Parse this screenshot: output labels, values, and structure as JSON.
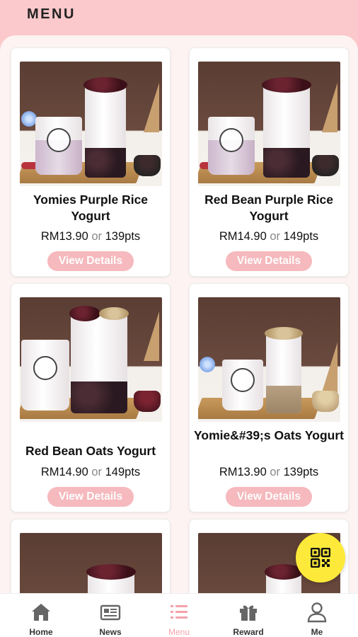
{
  "header": {
    "title": "MENU"
  },
  "products": [
    {
      "name": "Yomies Purple Rice Yogurt",
      "price": "RM13.90",
      "or": "or",
      "points": "139pts",
      "button": "View Details"
    },
    {
      "name": "Red Bean Purple Rice Yogurt",
      "price": "RM14.90",
      "or": "or",
      "points": "149pts",
      "button": "View Details"
    },
    {
      "name": "Red Bean Oats Yogurt",
      "price": "RM14.90",
      "or": "or",
      "points": "149pts",
      "button": "View Details"
    },
    {
      "name": "Yomie&#39;s Oats Yogurt",
      "price": "RM13.90",
      "or": "or",
      "points": "139pts",
      "button": "View Details"
    }
  ],
  "qr_button": {
    "icon": "qr-code-icon",
    "color": "#fde93a"
  },
  "nav": [
    {
      "label": "Home",
      "icon": "home-icon"
    },
    {
      "label": "News",
      "icon": "newspaper-icon"
    },
    {
      "label": "Menu",
      "icon": "menu-list-icon",
      "active": true
    },
    {
      "label": "Reward",
      "icon": "gift-icon"
    },
    {
      "label": "Me",
      "icon": "person-icon"
    }
  ],
  "colors": {
    "header_bg": "#fbc9cb",
    "button_bg": "#f6b9bd",
    "active_nav": "#f3a3ab"
  }
}
